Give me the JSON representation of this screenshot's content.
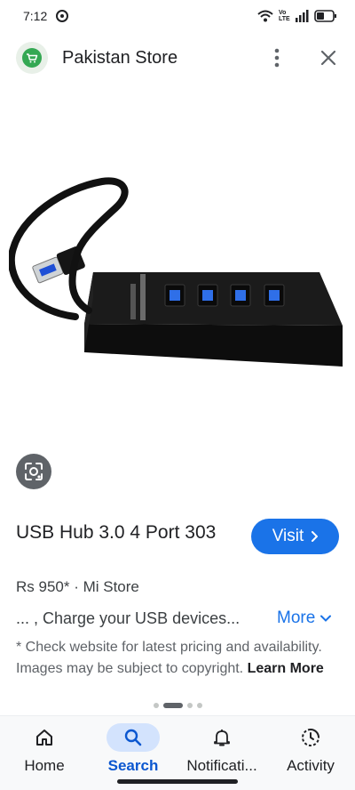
{
  "status_bar": {
    "time": "7:12",
    "icons": [
      "notification-dot-icon",
      "wifi-icon",
      "volte-icon",
      "signal-icon",
      "battery-icon"
    ],
    "volte_text": "Vo LTE"
  },
  "header": {
    "store_name": "Pakistan Store",
    "logo_icon": "shopping-cart-icon",
    "actions": [
      "more-vert-icon",
      "close-icon"
    ]
  },
  "image": {
    "subject": "usb-hub-product-photo",
    "lens_icon": "google-lens-icon"
  },
  "product": {
    "title": "USB Hub 3.0 4 Port 303",
    "price_line": "Rs 950* · Mi Store",
    "description": "... , Charge your USB devices...",
    "more_label": "More",
    "disclaimer": "* Check website for latest pricing and availability. Images may be subject to copyright.",
    "learn_more": "Learn More"
  },
  "visit_button": {
    "label": "Visit"
  },
  "pager": {
    "count": 4,
    "active_index": 1
  },
  "bottom_nav": {
    "items": [
      {
        "label": "Home",
        "icon": "home-icon"
      },
      {
        "label": "Search",
        "icon": "search-icon"
      },
      {
        "label": "Notificati...",
        "icon": "bell-icon"
      },
      {
        "label": "Activity",
        "icon": "activity-icon"
      }
    ],
    "active_index": 1
  },
  "colors": {
    "accent": "#1a73e8",
    "active_nav_pill": "#d3e3fd",
    "active_nav_text": "#0b57d0"
  }
}
